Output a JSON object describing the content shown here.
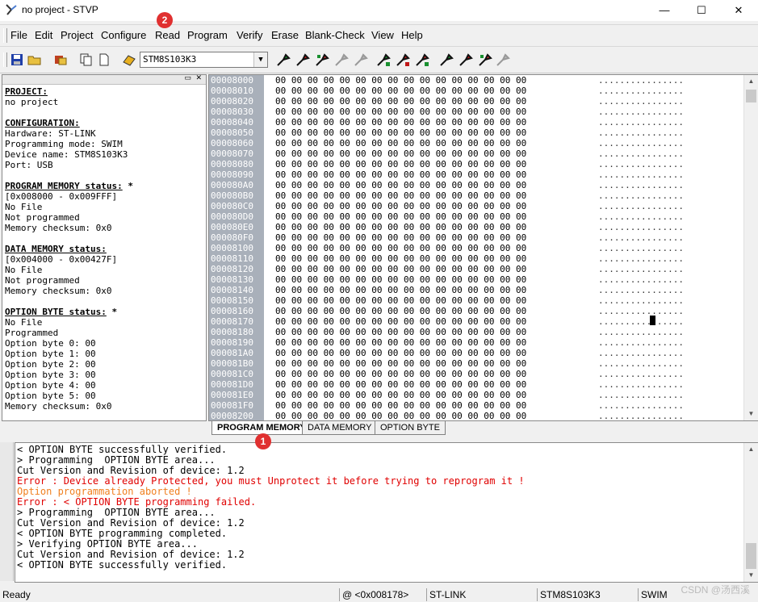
{
  "window": {
    "title": "no project - STVP",
    "minimize": "—",
    "maximize": "☐",
    "close": "✕"
  },
  "menu": [
    "File",
    "Edit",
    "Project",
    "Configure",
    "Read",
    "Program",
    "Verify",
    "Erase",
    "Blank-Check",
    "View",
    "Help"
  ],
  "toolbar": {
    "device": "STM8S103K3"
  },
  "left_panel": {
    "lines": [
      {
        "t": "PROJECT:",
        "h": true
      },
      {
        "t": "no project"
      },
      {
        "t": ""
      },
      {
        "t": "CONFIGURATION:",
        "h": true
      },
      {
        "t": "Hardware: ST-LINK"
      },
      {
        "t": "Programming mode: SWIM"
      },
      {
        "t": "Device name: STM8S103K3"
      },
      {
        "t": "Port: USB"
      },
      {
        "t": ""
      },
      {
        "t": "PROGRAM MEMORY status:",
        "h": true,
        "suffix": " *"
      },
      {
        "t": "[0x008000 - 0x009FFF]"
      },
      {
        "t": "No File"
      },
      {
        "t": "Not programmed"
      },
      {
        "t": "Memory checksum: 0x0"
      },
      {
        "t": ""
      },
      {
        "t": "DATA MEMORY status:",
        "h": true
      },
      {
        "t": "[0x004000 - 0x00427F]"
      },
      {
        "t": "No File"
      },
      {
        "t": "Not programmed"
      },
      {
        "t": "Memory checksum: 0x0"
      },
      {
        "t": ""
      },
      {
        "t": "OPTION BYTE status:",
        "h": true,
        "suffix": " *"
      },
      {
        "t": "No File"
      },
      {
        "t": "Programmed"
      },
      {
        "t": "Option byte 0: 00"
      },
      {
        "t": "Option byte 1: 00"
      },
      {
        "t": "Option byte 2: 00"
      },
      {
        "t": "Option byte 3: 00"
      },
      {
        "t": "Option byte 4: 00"
      },
      {
        "t": "Option byte 5: 00"
      },
      {
        "t": "Memory checksum: 0x0"
      }
    ]
  },
  "hex": {
    "addresses": [
      "00008000",
      "00008010",
      "00008020",
      "00008030",
      "00008040",
      "00008050",
      "00008060",
      "00008070",
      "00008080",
      "00008090",
      "000080A0",
      "000080B0",
      "000080C0",
      "000080D0",
      "000080E0",
      "000080F0",
      "00008100",
      "00008110",
      "00008120",
      "00008130",
      "00008140",
      "00008150",
      "00008160",
      "00008170",
      "00008180",
      "00008190",
      "000081A0",
      "000081B0",
      "000081C0",
      "000081D0",
      "000081E0",
      "000081F0",
      "00008200"
    ],
    "bytes": "00 00 00 00 00 00 00 00 00 00 00 00 00 00 00 00",
    "ascii": "................"
  },
  "tabs": [
    "PROGRAM MEMORY",
    "DATA MEMORY",
    "OPTION BYTE"
  ],
  "log": [
    {
      "t": "< OPTION BYTE successfully verified.",
      "c": "#000000"
    },
    {
      "t": "> Programming  OPTION BYTE area...",
      "c": "#000000"
    },
    {
      "t": "Cut Version and Revision of device: 1.2",
      "c": "#000000"
    },
    {
      "t": "Error : Device already Protected, you must Unprotect it before trying to reprogram it !",
      "c": "#e00000"
    },
    {
      "t": "Option programmation aborted !",
      "c": "#f08020"
    },
    {
      "t": "Error : < OPTION BYTE programming failed.",
      "c": "#e00000"
    },
    {
      "t": "> Programming  OPTION BYTE area...",
      "c": "#000000"
    },
    {
      "t": "Cut Version and Revision of device: 1.2",
      "c": "#000000"
    },
    {
      "t": "< OPTION BYTE programming completed.",
      "c": "#000000"
    },
    {
      "t": "> Verifying OPTION BYTE area...",
      "c": "#000000"
    },
    {
      "t": "Cut Version and Revision of device: 1.2",
      "c": "#000000"
    },
    {
      "t": "< OPTION BYTE successfully verified.",
      "c": "#000000"
    }
  ],
  "status": {
    "ready": "Ready",
    "address": "@ <0x008178>",
    "hardware": "ST-LINK",
    "device": "STM8S103K3",
    "mode": "SWIM"
  },
  "badges": [
    "2",
    "1"
  ],
  "watermark": "CSDN @汤西溪"
}
